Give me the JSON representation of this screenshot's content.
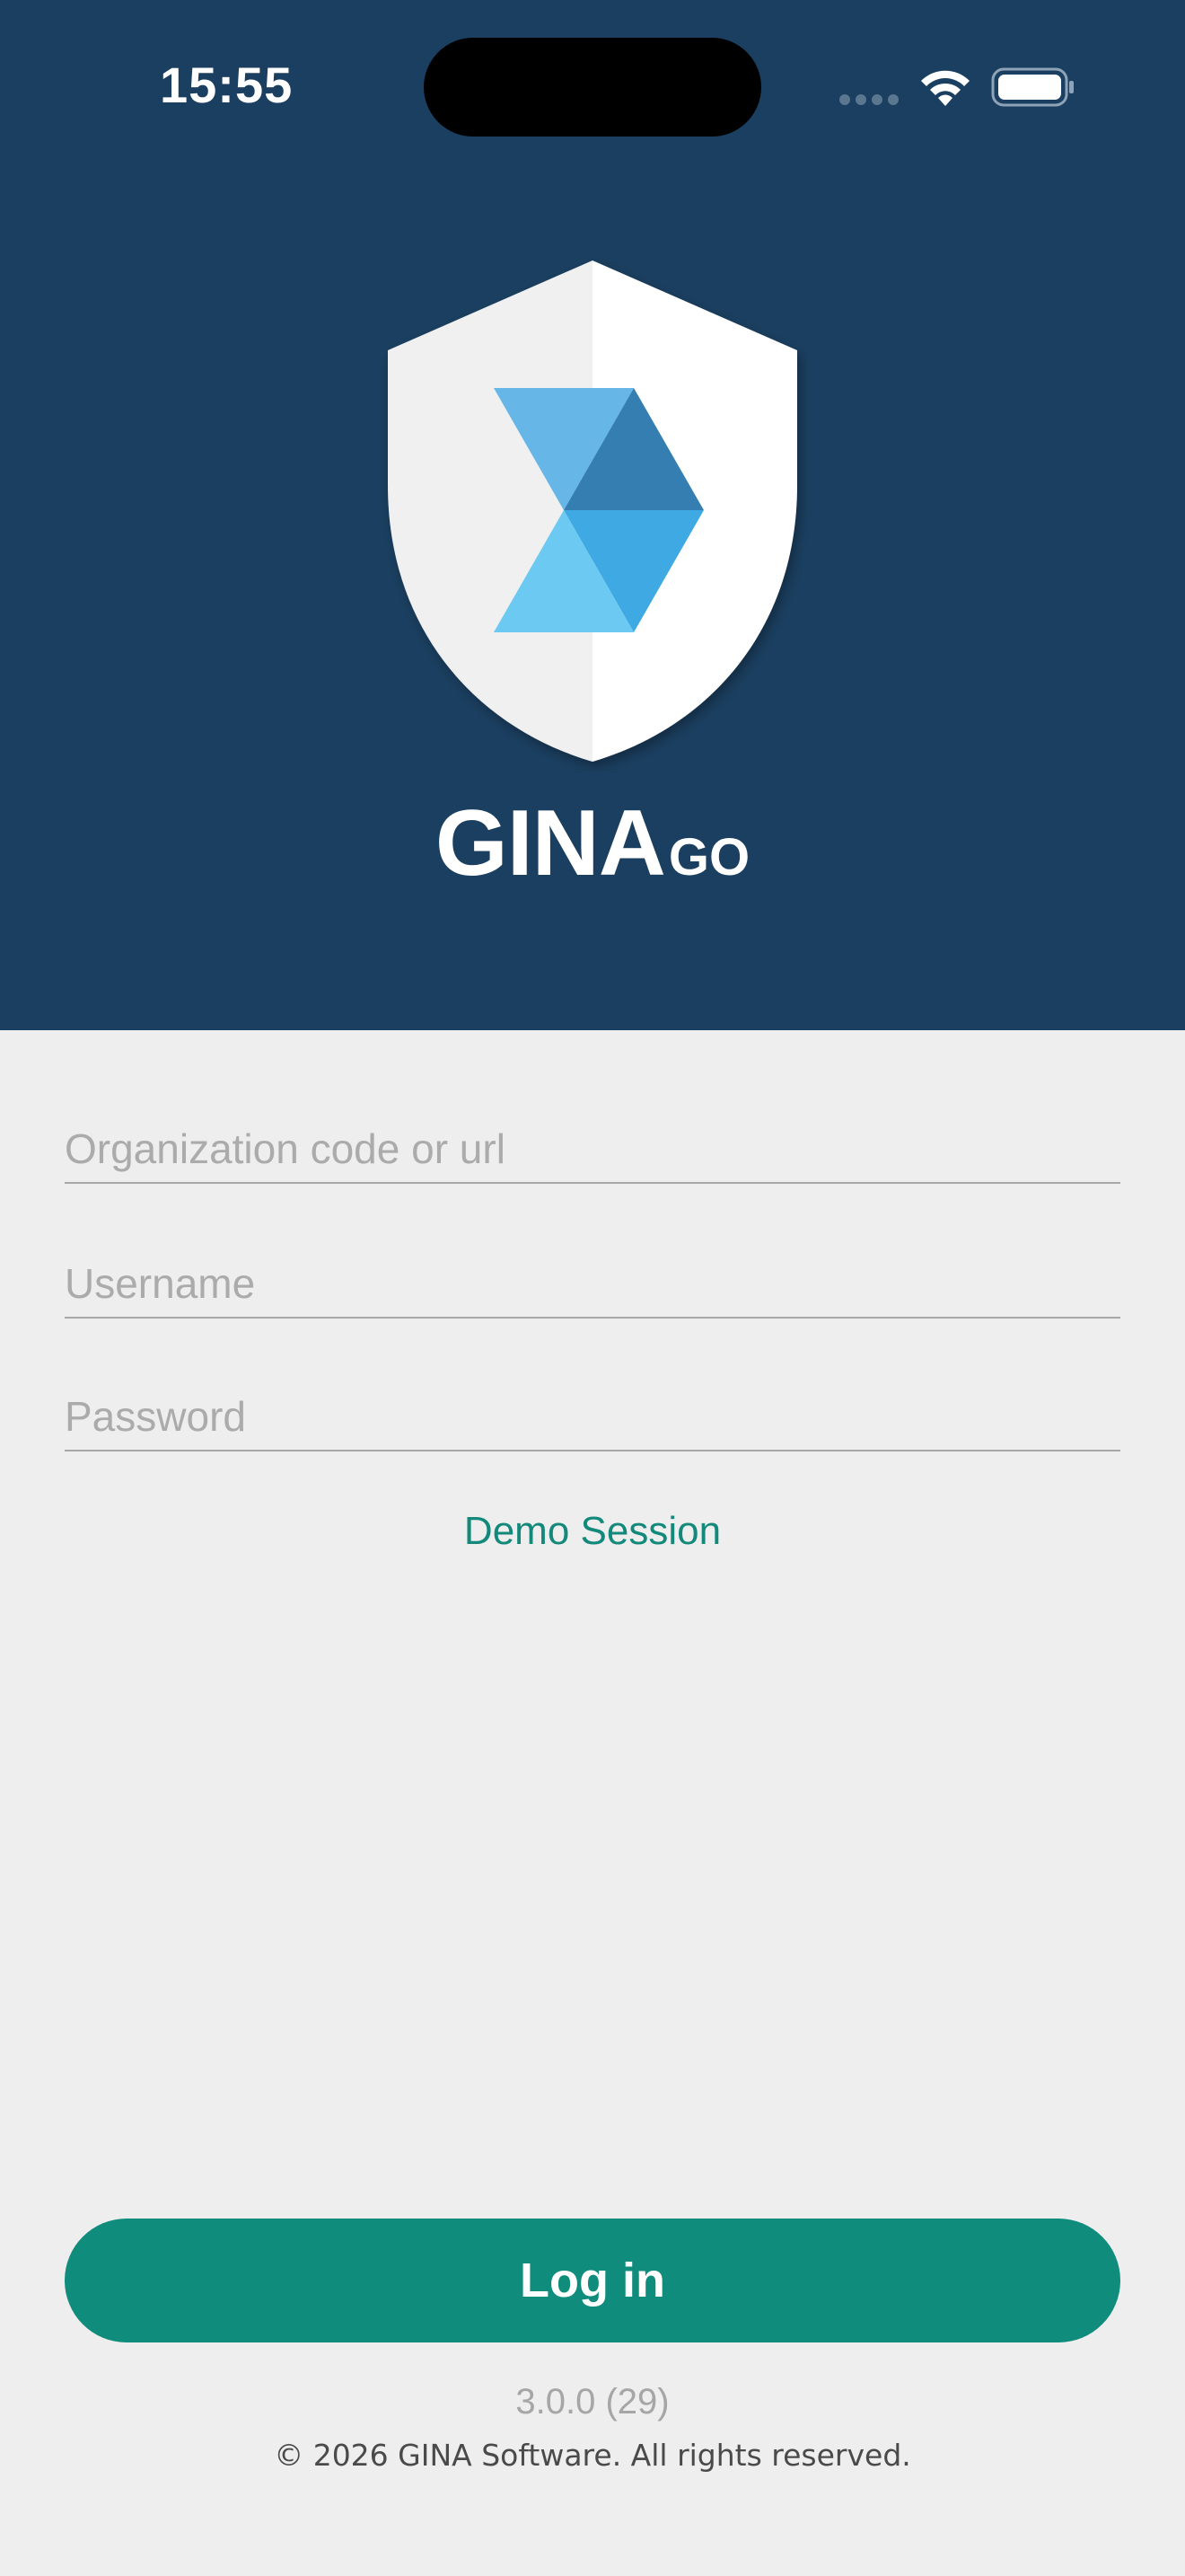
{
  "status_bar": {
    "time": "15:55",
    "icons": [
      "signal-icon",
      "wifi-icon",
      "battery-icon"
    ]
  },
  "brand": {
    "name": "GINA",
    "suffix": "GO",
    "logo_icon": "shield-logo-icon"
  },
  "form": {
    "organization": {
      "placeholder": "Organization code or url",
      "value": ""
    },
    "username": {
      "placeholder": "Username",
      "value": ""
    },
    "password": {
      "placeholder": "Password",
      "value": ""
    }
  },
  "demo_session_label": "Demo Session",
  "login_label": "Log in",
  "version": "3.0.0 (29)",
  "copyright": "© 2026 GINA Software. All rights reserved.",
  "colors": {
    "header_bg": "#1b3f60",
    "accent": "#0f8c7c",
    "page_bg": "#eeeeee"
  }
}
